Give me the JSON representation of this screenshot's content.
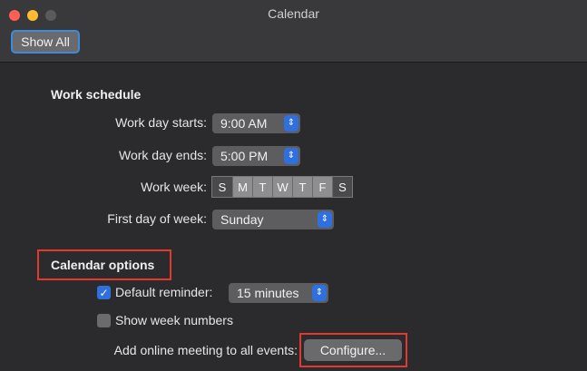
{
  "window": {
    "title": "Calendar",
    "show_all_label": "Show All"
  },
  "work_schedule": {
    "title": "Work schedule",
    "day_starts_label": "Work day starts:",
    "day_starts_value": "9:00 AM",
    "day_ends_label": "Work day ends:",
    "day_ends_value": "5:00 PM",
    "week_label": "Work week:",
    "days": [
      {
        "letter": "S",
        "selected": false
      },
      {
        "letter": "M",
        "selected": true
      },
      {
        "letter": "T",
        "selected": true
      },
      {
        "letter": "W",
        "selected": true
      },
      {
        "letter": "T",
        "selected": true
      },
      {
        "letter": "F",
        "selected": true
      },
      {
        "letter": "S",
        "selected": false
      }
    ],
    "first_day_label": "First day of week:",
    "first_day_value": "Sunday"
  },
  "calendar_options": {
    "title": "Calendar options",
    "default_reminder_label": "Default reminder:",
    "default_reminder_checked": true,
    "default_reminder_value": "15 minutes",
    "show_week_numbers_label": "Show week numbers",
    "show_week_numbers_checked": false,
    "online_meeting_label": "Add online meeting to all events:",
    "configure_label": "Configure..."
  },
  "icons": {
    "stepper": "up-down-chevron-icon",
    "check": "checkmark-icon"
  },
  "colors": {
    "accent": "#2f6fde",
    "highlight_box": "#e03a2e"
  }
}
